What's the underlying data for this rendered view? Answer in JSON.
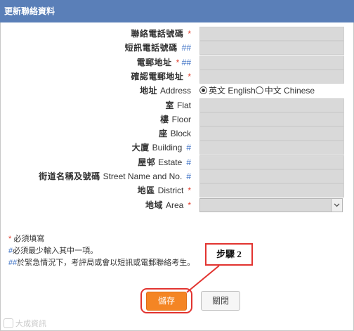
{
  "window": {
    "title": "更新聯絡資料"
  },
  "form": {
    "fields": [
      {
        "id": "phone",
        "zh": "聯絡電話號碼",
        "en": "",
        "mark": "*",
        "mark_type": "req",
        "control": "text"
      },
      {
        "id": "sms",
        "zh": "短訊電話號碼",
        "en": "",
        "mark": "##",
        "mark_type": "opt",
        "control": "text"
      },
      {
        "id": "email",
        "zh": "電郵地址",
        "en": "",
        "mark": "* ##",
        "mark_type": "mixed",
        "control": "text"
      },
      {
        "id": "email_confirm",
        "zh": "確認電郵地址",
        "en": "",
        "mark": "*",
        "mark_type": "req",
        "control": "text"
      },
      {
        "id": "address",
        "zh": "地址",
        "en": "Address",
        "mark": "",
        "mark_type": "none",
        "control": "radio"
      },
      {
        "id": "flat",
        "zh": "室",
        "en": "Flat",
        "mark": "",
        "mark_type": "none",
        "control": "text"
      },
      {
        "id": "floor",
        "zh": "樓",
        "en": "Floor",
        "mark": "",
        "mark_type": "none",
        "control": "text"
      },
      {
        "id": "block",
        "zh": "座",
        "en": "Block",
        "mark": "",
        "mark_type": "none",
        "control": "text"
      },
      {
        "id": "building",
        "zh": "大廈",
        "en": "Building",
        "mark": "#",
        "mark_type": "opt",
        "control": "text"
      },
      {
        "id": "estate",
        "zh": "屋邨",
        "en": "Estate",
        "mark": "#",
        "mark_type": "opt",
        "control": "text"
      },
      {
        "id": "street",
        "zh": "街道名稱及號碼",
        "en": "Street Name and No.",
        "mark": "#",
        "mark_type": "opt",
        "control": "text"
      },
      {
        "id": "district",
        "zh": "地區",
        "en": "District",
        "mark": "*",
        "mark_type": "req",
        "control": "text"
      },
      {
        "id": "area",
        "zh": "地域",
        "en": "Area",
        "mark": "*",
        "mark_type": "req",
        "control": "select"
      }
    ],
    "address_lang": {
      "option_en": "英文 English",
      "option_zh": "中文 Chinese",
      "selected": "en"
    }
  },
  "notes": {
    "required_mark": "*",
    "required_text": "必須填寫",
    "hash_mark": "#",
    "hash_text": "必須最少輸入其中一項。",
    "double_hash_mark": "##",
    "double_hash_text": "於緊急情況下，考評局或會以短訊或電郵聯絡考生。"
  },
  "callout": {
    "text": "步驟 2"
  },
  "buttons": {
    "save": "儲存",
    "close": "關閉"
  },
  "watermark": {
    "text": "大成資訊"
  },
  "colors": {
    "title_bar": "#5a7fb8",
    "required": "#e03b2a",
    "optional": "#3a6fc4",
    "save_button": "#f48524",
    "highlight": "#e23430",
    "input_fill": "#d9d9d9"
  }
}
